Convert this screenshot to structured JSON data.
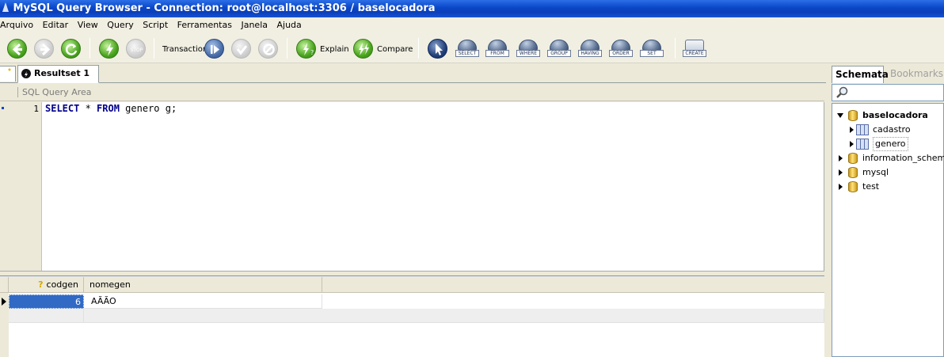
{
  "window": {
    "title": "MySQL Query Browser - Connection: root@localhost:3306 / baselocadora"
  },
  "menu": [
    "Arquivo",
    "Editar",
    "View",
    "Query",
    "Script",
    "Ferramentas",
    "Janela",
    "Ajuda"
  ],
  "toolbar": {
    "transaction_label": "Transaction",
    "explain_label": "Explain",
    "compare_label": "Compare",
    "stop_label": "STOP",
    "clauses": [
      "SELECT",
      "FROM",
      "WHERE",
      "GROUP",
      "HAVING",
      "ORDER",
      "SET"
    ],
    "create_label": "CREATE"
  },
  "tabs": {
    "active": "Resultset 1"
  },
  "sql_area": {
    "header": "SQL Query Area",
    "line_number": "1",
    "query": {
      "kw1": "SELECT",
      "rest1": " * ",
      "kw2": "FROM",
      "rest2": " genero g;"
    }
  },
  "result": {
    "columns": [
      "codgen",
      "nomegen"
    ],
    "rows": [
      {
        "codgen": "6",
        "nomegen": "AÃÃO"
      }
    ]
  },
  "right_panel": {
    "tabs": [
      "Schemata",
      "Bookmarks"
    ],
    "schemas": [
      {
        "name": "baselocadora",
        "expanded": true,
        "tables": [
          "cadastro",
          "genero"
        ]
      },
      {
        "name": "information_schema"
      },
      {
        "name": "mysql"
      },
      {
        "name": "test"
      }
    ]
  }
}
